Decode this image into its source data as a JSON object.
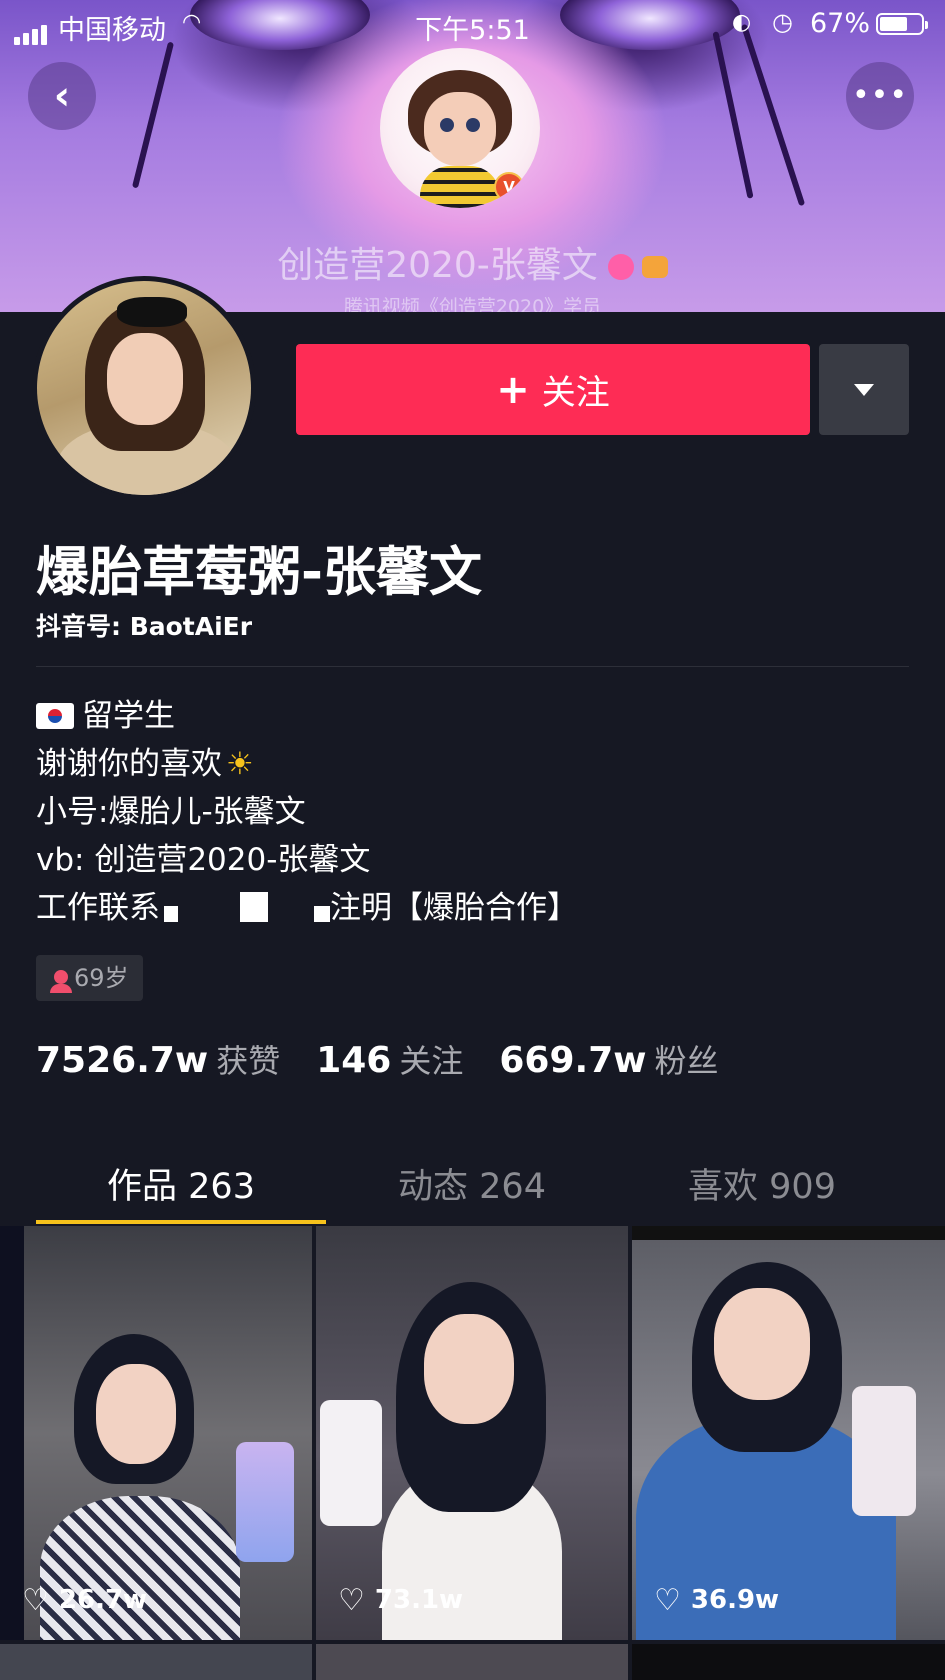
{
  "status_bar": {
    "carrier": "中国移动",
    "time": "下午5:51",
    "battery_percent": "67%",
    "battery_level": 0.67
  },
  "banner": {
    "title": "创造营2020-张馨文",
    "subtitle": "腾讯视频《创造营2020》学员"
  },
  "header": {
    "follow_label": "关注",
    "follow_plus": "+"
  },
  "profile": {
    "nickname": "爆胎草莓粥-张馨文",
    "douyin_id": "抖音号: BaotAiEr",
    "bio": {
      "line1": "留学生",
      "line2": "谢谢你的喜欢",
      "line2_emoji": "☀",
      "line3": "小号:爆胎儿-张馨文",
      "line4": "vb: 创造营2020-张馨文",
      "line5_prefix": "工作联系",
      "line5_suffix": "注明【爆胎合作】"
    },
    "age_tag": "69岁"
  },
  "stats": {
    "likes_value": "7526.7w",
    "likes_label": "获赞",
    "following_value": "146",
    "following_label": "关注",
    "followers_value": "669.7w",
    "followers_label": "粉丝"
  },
  "tabs": [
    {
      "label": "作品 263",
      "active": true
    },
    {
      "label": "动态 264",
      "active": false
    },
    {
      "label": "喜欢 909",
      "active": false
    }
  ],
  "videos": [
    {
      "likes": "26.7w"
    },
    {
      "likes": "73.1w"
    },
    {
      "likes": "36.9w"
    }
  ],
  "colors": {
    "background": "#161823",
    "follow_button": "#fe2c55",
    "tab_indicator": "#f6c21c",
    "secondary_text": "#a9aab0"
  },
  "icons": {
    "back": "back-chevron-icon",
    "more": "more-dots-icon",
    "dropdown": "dropdown-triangle-icon",
    "heart": "heart-outline-icon"
  }
}
